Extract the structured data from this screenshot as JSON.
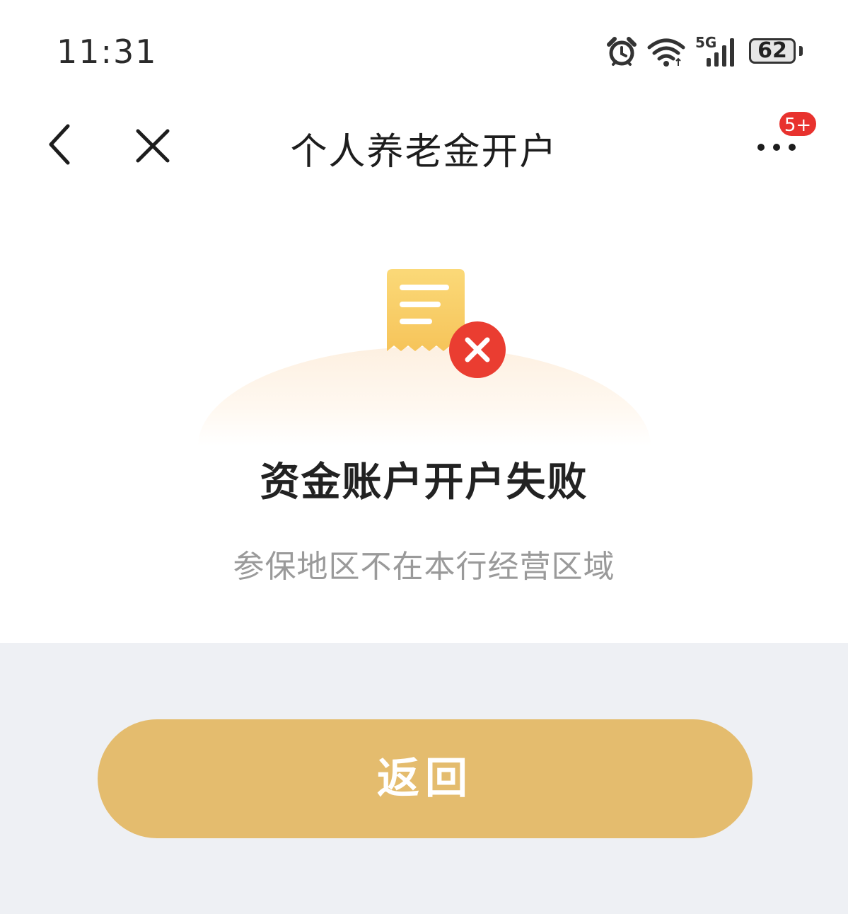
{
  "status_bar": {
    "time": "11:31",
    "network_label": "5G",
    "battery_level": "62",
    "icons": [
      "alarm-icon",
      "wifi-icon",
      "signal-5g-icon",
      "battery-icon"
    ]
  },
  "nav": {
    "title": "个人养老金开户",
    "badge": "5+",
    "icons": [
      "back-arrow-icon",
      "close-icon",
      "more-icon"
    ]
  },
  "result": {
    "title": "资金账户开户失败",
    "subtitle": "参保地区不在本行经营区域",
    "icons": [
      "receipt-icon",
      "error-x-icon"
    ]
  },
  "actions": {
    "return_label": "返回"
  },
  "colors": {
    "accent_gold": "#e4bc6e",
    "error_red": "#e8322e",
    "bottom_bg": "#eef0f4"
  }
}
